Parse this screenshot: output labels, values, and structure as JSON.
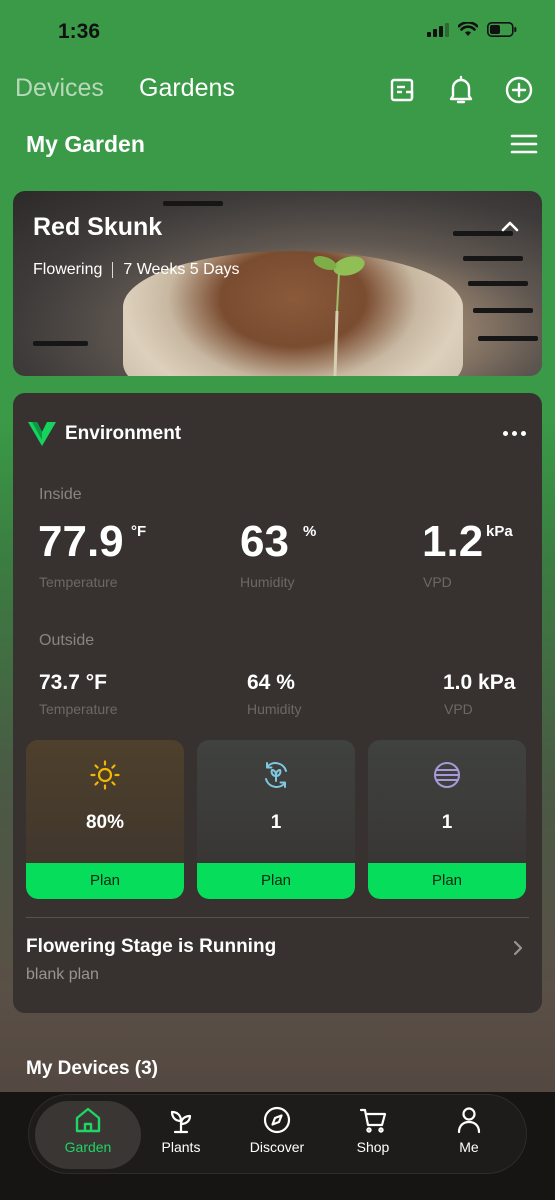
{
  "status_bar": {
    "time": "1:36"
  },
  "top_nav": {
    "tabs": [
      {
        "label": "Devices",
        "active": false
      },
      {
        "label": "Gardens",
        "active": true
      }
    ],
    "icons": [
      "notes-icon",
      "bell-icon",
      "add-circle-icon"
    ]
  },
  "garden": {
    "title": "My Garden"
  },
  "plant": {
    "name": "Red Skunk",
    "stage": "Flowering",
    "age": "7 Weeks 5 Days"
  },
  "environment": {
    "title": "Environment",
    "inside": {
      "label": "Inside",
      "temperature": {
        "value": "77.9",
        "unit": "°F",
        "label": "Temperature"
      },
      "humidity": {
        "value": "63",
        "unit": "%",
        "label": "Humidity"
      },
      "vpd": {
        "value": "1.2",
        "unit": "kPa",
        "label": "VPD"
      }
    },
    "outside": {
      "label": "Outside",
      "temperature": {
        "value": "73.7 °F",
        "label": "Temperature"
      },
      "humidity": {
        "value": "64 %",
        "label": "Humidity"
      },
      "vpd": {
        "value": "1.0 kPa",
        "label": "VPD"
      }
    },
    "tiles": [
      {
        "icon": "sun-icon",
        "value": "80%",
        "button": "Plan",
        "accent": "#f5b800"
      },
      {
        "icon": "cycle-leaf-icon",
        "value": "1",
        "button": "Plan",
        "accent": "#7ec8e3"
      },
      {
        "icon": "fan-lines-icon",
        "value": "1",
        "button": "Plan",
        "accent": "#a89ad8"
      }
    ],
    "stage": {
      "title": "Flowering Stage is Running",
      "subtitle": "blank plan"
    }
  },
  "devices": {
    "title": "My Devices (3)"
  },
  "tab_bar": {
    "items": [
      {
        "label": "Garden",
        "icon": "home-icon",
        "active": true
      },
      {
        "label": "Plants",
        "icon": "sprout-icon",
        "active": false
      },
      {
        "label": "Discover",
        "icon": "compass-icon",
        "active": false
      },
      {
        "label": "Shop",
        "icon": "cart-icon",
        "active": false
      },
      {
        "label": "Me",
        "icon": "person-icon",
        "active": false
      }
    ]
  },
  "colors": {
    "brand_green": "#3a9a47",
    "accent_green": "#06dd5a",
    "card_bg": "#373230"
  }
}
